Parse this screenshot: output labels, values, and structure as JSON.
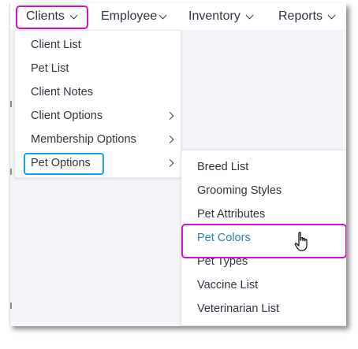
{
  "nav": {
    "items": [
      {
        "label": "Clients"
      },
      {
        "label": "Employee"
      },
      {
        "label": "Inventory"
      },
      {
        "label": "Reports"
      }
    ]
  },
  "clients_menu": {
    "items": [
      {
        "label": "Client List"
      },
      {
        "label": "Pet List"
      },
      {
        "label": "Client Notes"
      },
      {
        "label": "Client Options"
      },
      {
        "label": "Membership Options"
      },
      {
        "label": "Pet Options"
      }
    ]
  },
  "pet_options_menu": {
    "items": [
      {
        "label": "Breed List"
      },
      {
        "label": "Grooming Styles"
      },
      {
        "label": "Pet Attributes"
      },
      {
        "label": "Pet Colors"
      },
      {
        "label": "Pet Types"
      },
      {
        "label": "Vaccine List"
      },
      {
        "label": "Veterinarian List"
      }
    ]
  },
  "colors": {
    "highlight_magenta": "#d40fc4",
    "highlight_blue": "#1aa0e0",
    "hover_text": "#2e7fa8"
  },
  "icons": [
    "chevron-down-icon",
    "chevron-right-icon",
    "hand-pointer-icon"
  ]
}
